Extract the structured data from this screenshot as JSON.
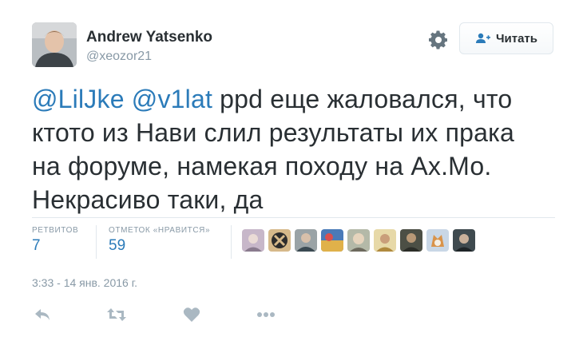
{
  "user": {
    "display_name": "Andrew Yatsenko",
    "handle": "@xeozor21",
    "avatar_icon": "user-avatar-photo"
  },
  "follow_button": {
    "label": "Читать",
    "icon": "add-user-icon"
  },
  "settings_icon": "gear-icon",
  "tweet": {
    "mentions": [
      "@LilJke",
      "@v1lat"
    ],
    "body_line1": "ppd еще жаловался, что",
    "body_line2": "ктото из Нави слил результаты их прака",
    "body_line3": "на форуме, намекая походу на Ах.Мо.",
    "body_line4": "Некрасиво таки, да"
  },
  "stats": {
    "retweets_label": "РЕТВИТОВ",
    "retweets_value": "7",
    "likes_label": "ОТМЕТОК «НРАВИТСЯ»",
    "likes_value": "59"
  },
  "facepile_count": 9,
  "timestamp": "3:33 - 14 янв. 2016 г.",
  "actions": [
    "reply-icon",
    "retweet-icon",
    "like-icon",
    "more-icon"
  ],
  "colors": {
    "link": "#2b7bb9",
    "muted": "#8899a6",
    "text": "#292f33",
    "divider": "#e1e8ed",
    "action_icon": "#aab8c2"
  }
}
